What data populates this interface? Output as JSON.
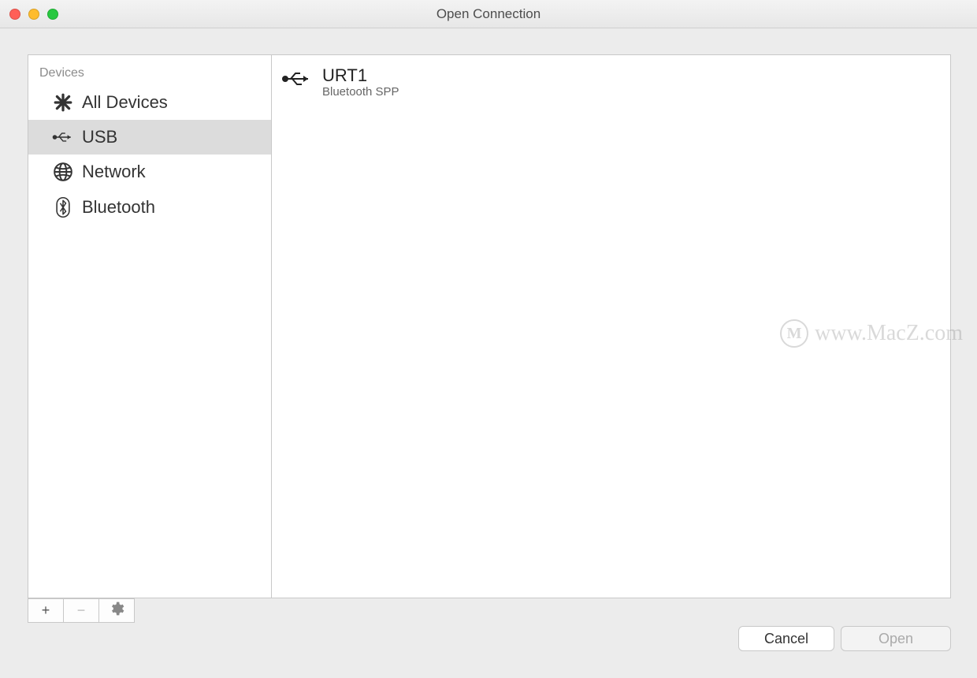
{
  "window": {
    "title": "Open Connection"
  },
  "sidebar": {
    "section_header": "Devices",
    "items": [
      {
        "label": "All Devices",
        "icon": "asterisk-icon",
        "selected": false
      },
      {
        "label": "USB",
        "icon": "usb-icon",
        "selected": true
      },
      {
        "label": "Network",
        "icon": "globe-icon",
        "selected": false
      },
      {
        "label": "Bluetooth",
        "icon": "bluetooth-icon",
        "selected": false
      }
    ]
  },
  "devices": [
    {
      "name": "URT1",
      "subtitle": "Bluetooth SPP",
      "icon": "usb-plug-icon"
    }
  ],
  "toolbar": {
    "add_tooltip": "+",
    "remove_tooltip": "−",
    "settings_tooltip": "⚙"
  },
  "footer": {
    "cancel_label": "Cancel",
    "open_label": "Open"
  },
  "watermark": {
    "badge": "M",
    "text": "www.MacZ.com"
  }
}
